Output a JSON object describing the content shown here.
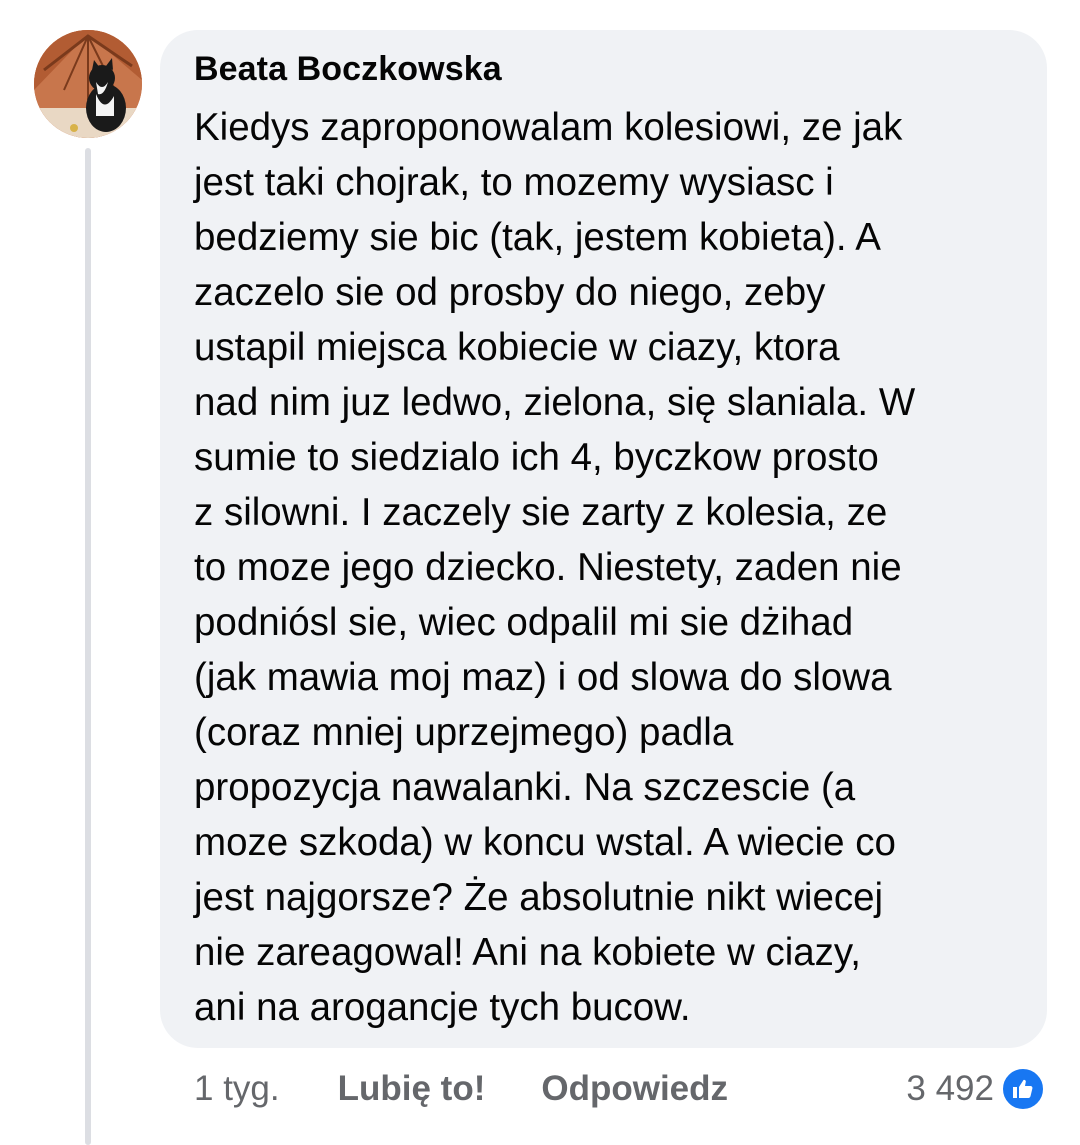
{
  "comment": {
    "author": "Beata Boczkowska",
    "lines": [
      "Kiedys zaproponowalam kolesiowi, ze jak",
      "jest taki chojrak, to mozemy wysiasc i",
      "bedziemy sie bic (tak, jestem kobieta). A",
      "zaczelo sie od prosby do niego, zeby",
      "ustapil miejsca kobiecie w ciazy, ktora",
      "nad nim juz ledwo, zielona, się slaniala. W",
      "sumie to siedzialo ich 4, byczkow prosto",
      "z silowni. I zaczely sie zarty z kolesia, ze",
      "to moze jego dziecko. Niestety, zaden nie",
      "podniósl sie, wiec odpalil mi sie dżihad",
      "(jak mawia moj maz) i od slowa do slowa",
      "(coraz mniej uprzejmego) padla",
      "propozycja nawalanki. Na szczescie (a",
      "moze szkoda) w koncu wstal. A wiecie co",
      "jest najgorsze? Że absolutnie nikt wiecej",
      "nie zareagowal! Ani na kobiete w ciazy,",
      "ani na arogancje tych bucow."
    ]
  },
  "actions": {
    "time": "1 tyg.",
    "like_label": "Lubię to!",
    "reply_label": "Odpowiedz"
  },
  "reactions": {
    "count": "3 492",
    "icon": "thumbs-up-icon",
    "icon_color": "#1877f2"
  },
  "colors": {
    "bubble": "#f0f2f5",
    "text": "#050505",
    "secondary": "#65676b"
  }
}
